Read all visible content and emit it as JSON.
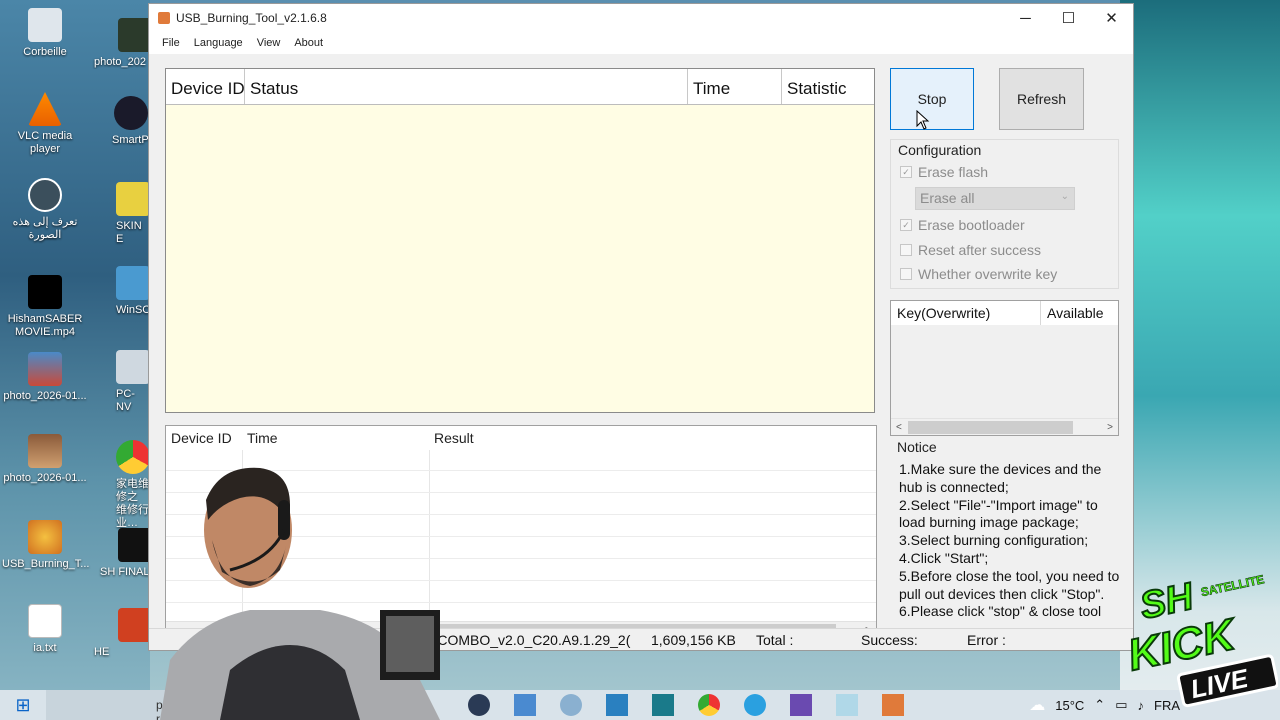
{
  "desktop_icons": [
    {
      "label": "Corbeille"
    },
    {
      "label": "VLC media player"
    },
    {
      "label": "تعرف إلى هذه الصورة"
    },
    {
      "label": "HishamSABER MOVIE.mp4"
    },
    {
      "label": "photo_2026-01..."
    },
    {
      "label": "photo_2026-01..."
    },
    {
      "label": "USB_Burning_T..."
    },
    {
      "label": "ia.txt"
    },
    {
      "label": "photo_202"
    },
    {
      "label": "SmartP"
    },
    {
      "label": "SKIN E"
    },
    {
      "label": "WinSC"
    },
    {
      "label": "PC-NV"
    },
    {
      "label": "家电维修之 维修行业…"
    },
    {
      "label": "SH FINAL"
    },
    {
      "label": "HE"
    }
  ],
  "window": {
    "title": "USB_Burning_Tool_v2.1.6.8",
    "minimize": "─",
    "maximize": "☐",
    "close": "✕"
  },
  "menu": [
    "File",
    "Language",
    "View",
    "About"
  ],
  "device_table": {
    "columns": [
      "Device ID",
      "Status",
      "Time",
      "Statistic"
    ]
  },
  "buttons": {
    "stop": "Stop",
    "refresh": "Refresh"
  },
  "configuration": {
    "title": "Configuration",
    "erase_flash": {
      "label": "Erase flash",
      "checked": true
    },
    "erase_mode": "Erase all",
    "erase_bootloader": {
      "label": "Erase bootloader",
      "checked": true
    },
    "reset_after_success": {
      "label": "Reset after success",
      "checked": false
    },
    "overwrite_key": {
      "label": "Whether overwrite key",
      "checked": false
    }
  },
  "key_table": {
    "columns": [
      "Key(Overwrite)",
      "Available"
    ]
  },
  "result_table": {
    "columns": [
      "Device ID",
      "Time",
      "Result"
    ]
  },
  "notice": {
    "title": "Notice",
    "lines": [
      "1.Make sure the devices and the hub is connected;",
      "2.Select \"File\"-\"Import image\" to load burning image package;",
      "3.Select burning configuration;",
      "4.Click \"Start\";",
      "5.Before close the tool, you need to pull out devices then click \"Stop\".",
      "6.Please click \"stop\" & close tool"
    ]
  },
  "statusbar": {
    "image": "ombo_TCOMBO_v2.0_C20.A9.1.29_2(",
    "size": "1,609,156 KB",
    "total": "Total :",
    "success": "Success:",
    "error": "Error :"
  },
  "taskbar": {
    "search_placeholder": "pour reche",
    "weather": "15°C",
    "language": "FRA"
  },
  "overlay": {
    "badge_top": "SH",
    "badge_sub": "SATELLITE",
    "badge_main": "KICK",
    "badge_live": "LIVE"
  }
}
